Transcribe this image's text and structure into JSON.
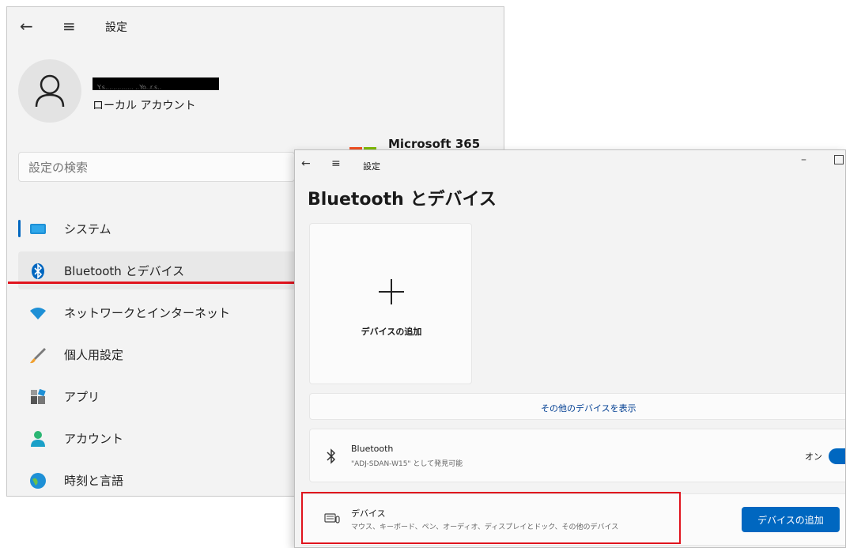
{
  "win1": {
    "title": "設定",
    "account": {
      "name": "Y.s.............. ..Yo..r.s..",
      "type": "ローカル アカウント"
    },
    "microsoft365": "Microsoft 365",
    "search_placeholder": "設定の検索",
    "nav": [
      {
        "label": "システム",
        "icon": "monitor-icon"
      },
      {
        "label": "Bluetooth とデバイス",
        "icon": "bluetooth-icon"
      },
      {
        "label": "ネットワークとインターネット",
        "icon": "wifi-icon"
      },
      {
        "label": "個人用設定",
        "icon": "brush-icon"
      },
      {
        "label": "アプリ",
        "icon": "apps-icon"
      },
      {
        "label": "アカウント",
        "icon": "person-icon"
      },
      {
        "label": "時刻と言語",
        "icon": "globe-icon"
      }
    ]
  },
  "win2": {
    "title": "設定",
    "heading": "Bluetooth とデバイス",
    "add_card_label": "デバイスの追加",
    "more_devices": "その他のデバイスを表示",
    "bluetooth": {
      "title": "Bluetooth",
      "subtitle": "\"ADJ-SDAN-W15\" として発見可能",
      "toggle_label": "オン"
    },
    "devices": {
      "title": "デバイス",
      "subtitle": "マウス、キーボード、ペン、オーディオ、ディスプレイとドック、その他のデバイス",
      "button": "デバイスの追加"
    }
  },
  "colors": {
    "accent": "#0067c0",
    "highlight": "#e0141e"
  }
}
